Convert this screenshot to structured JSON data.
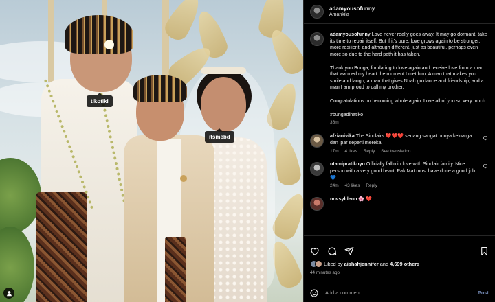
{
  "post": {
    "username": "adamyousofunny",
    "location": "Amankila"
  },
  "photo": {
    "tags": [
      "tikotiki",
      "itsmebd"
    ]
  },
  "caption": {
    "username": "adamyousofunny",
    "paragraphs": [
      "Love never really goes away. It may go dormant, take its time to repair itself. But if it's pure, love grows again to be stronger, more resilient, and although different, just as beautiful, perhaps even more so due to the hard path it has taken.",
      "Thank you Bunga, for daring to love again and receive love from a man that warmed my heart the moment I met him. A man that makes you smile and laugh, a man that gives Noah guidance and friendship, and a man I am proud to call my brother.",
      "Congratulations on becoming whole again. Love all of you so very much.",
      "#bungadihatiko"
    ],
    "time": "36m"
  },
  "comments": [
    {
      "username": "afzianivika",
      "text": "The Sinclairs ❤️❤️❤️ senang sangat punya keluarga dan ipar seperti mereka.",
      "time": "17m",
      "likes": "4 likes",
      "reply": "Reply",
      "translate": "See translation"
    },
    {
      "username": "utamipratiknyo",
      "text": "Officially fallin in love with Sinclair family. Nice person with a very good heart. Pak Mat must have done a good job 💙",
      "time": "24m",
      "likes": "43 likes",
      "reply": "Reply"
    },
    {
      "username": "novsyldenn",
      "text": "🌸 ❤️"
    }
  ],
  "engagement": {
    "liked_by_prefix": "Liked by ",
    "liked_by_user": "aishahjennifer",
    "liked_by_and": " and ",
    "likes_count": "4,699 others",
    "posted_ago": "44 minutes ago"
  },
  "comment_box": {
    "placeholder": "Add a comment...",
    "post_label": "Post"
  },
  "icons": [
    "heart-icon",
    "comment-icon",
    "share-icon",
    "bookmark-icon",
    "emoji-icon",
    "user-tag-icon"
  ],
  "colors": {
    "background": "#000000",
    "divider": "#262626",
    "muted_text": "#a8a8a8",
    "post_button": "#6a7ea6",
    "like_heart": "#ed4956"
  }
}
